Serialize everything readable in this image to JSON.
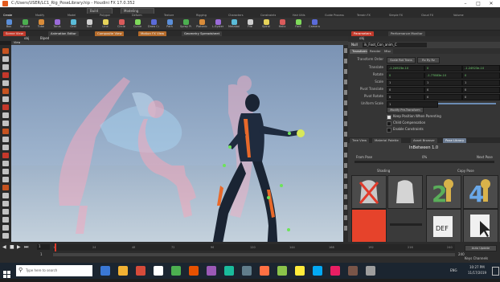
{
  "window": {
    "title": "C:/Users/USER/LC1_Rig_PoseLibrary.hip - Houdini FX 17.0.352",
    "controls": [
      "–",
      "□",
      "✕"
    ]
  },
  "menubar": {
    "items": [
      "File",
      "Edit",
      "Render",
      "Assets",
      "Windows",
      "Help"
    ],
    "build_label": "Build",
    "desktop_label": "Modeling"
  },
  "shelf": {
    "tabs": [
      "Create",
      "Modify",
      "Model",
      "Polygon",
      "Deform",
      "Texture",
      "Rigging",
      "Characters",
      "Constraints",
      "Hair Utils",
      "Guide Process",
      "Terrain FX",
      "Simple FX",
      "Cloud FX",
      "Volume"
    ],
    "tools": [
      "Box",
      "Sphere",
      "Tube",
      "Torus",
      "Grid",
      "Null",
      "Line",
      "Circle",
      "Curve",
      "Draw Curve",
      "Path",
      "Spray Paint",
      "Platonic",
      "L-System",
      "Metaball",
      "File",
      "Spiral",
      "Helix",
      "Font",
      "Camera"
    ]
  },
  "viewport_tabs": [
    "Scene View",
    "Animation Editor",
    "Composite View",
    "Motion FX View",
    "Geometry Spreadsheet"
  ],
  "viewport": {
    "path": "obj",
    "breadcrumb": "Biped",
    "view_label": "View"
  },
  "param_panel": {
    "tabs": [
      "Parameters",
      "Performance Monitor"
    ],
    "path": "obj",
    "node_type": "Null",
    "node_name": "ik_Foot_Con_anim_C",
    "subtabs": [
      "Transform",
      "Render",
      "Misc"
    ],
    "transform_order_label": "Transform Order",
    "transform_order_value": "Scale Rot Trans",
    "rotate_order_value": "Rx Ry Rz",
    "rows": [
      {
        "label": "Translate",
        "values": [
          "-1.24923e-10",
          "0",
          "-1.24923e-10"
        ]
      },
      {
        "label": "Rotate",
        "values": [
          "0",
          "-1.77883e-10",
          "0"
        ]
      },
      {
        "label": "Scale",
        "values": [
          "1",
          "1",
          "1"
        ]
      },
      {
        "label": "Pivot Translate",
        "values": [
          "0",
          "0",
          "0"
        ]
      },
      {
        "label": "Pivot Rotate",
        "values": [
          "0",
          "0",
          "0"
        ]
      },
      {
        "label": "Uniform Scale",
        "values": [
          "1"
        ]
      }
    ],
    "modify_pre_transform": "Modify Pre-Transform",
    "checkboxes": [
      {
        "label": "Keep Position When Parenting",
        "checked": true
      },
      {
        "label": "Child Compensation",
        "checked": false
      },
      {
        "label": "Enable Constraints",
        "checked": false
      }
    ]
  },
  "lower_tabs": [
    "Tree View",
    "Material Palette",
    "Asset Browser",
    "Pose Library"
  ],
  "pose_library": {
    "title": "InBetween 1.0",
    "from_pose_label": "From Pose",
    "to_pose_label": "Next Pose",
    "blend_value": "0%",
    "section_shading": "Shading",
    "section_copy": "Copy Pose",
    "swatch_color": "#e6432b"
  },
  "timeline": {
    "current_frame": "1",
    "start_frame": "1",
    "end_frame": "240",
    "ticks": [
      "1",
      "24",
      "48",
      "72",
      "96",
      "120",
      "144",
      "168",
      "192",
      "216",
      "240"
    ],
    "key_label": "Auto Update",
    "status": "Keys Channels"
  },
  "taskbar": {
    "search_placeholder": "Type here to search",
    "time": "10:27 PM",
    "date": "11/17/2019",
    "lang": "ENG",
    "app_colors": [
      "#3a78d6",
      "#f2b233",
      "#d64b3a",
      "#ffffff",
      "#4caf50",
      "#e65100",
      "#9b59b6",
      "#1abc9c",
      "#607d8b",
      "#ff7043",
      "#8bc34a",
      "#ffeb3b",
      "#03a9f4",
      "#e91e63",
      "#795548",
      "#9e9e9e"
    ]
  }
}
